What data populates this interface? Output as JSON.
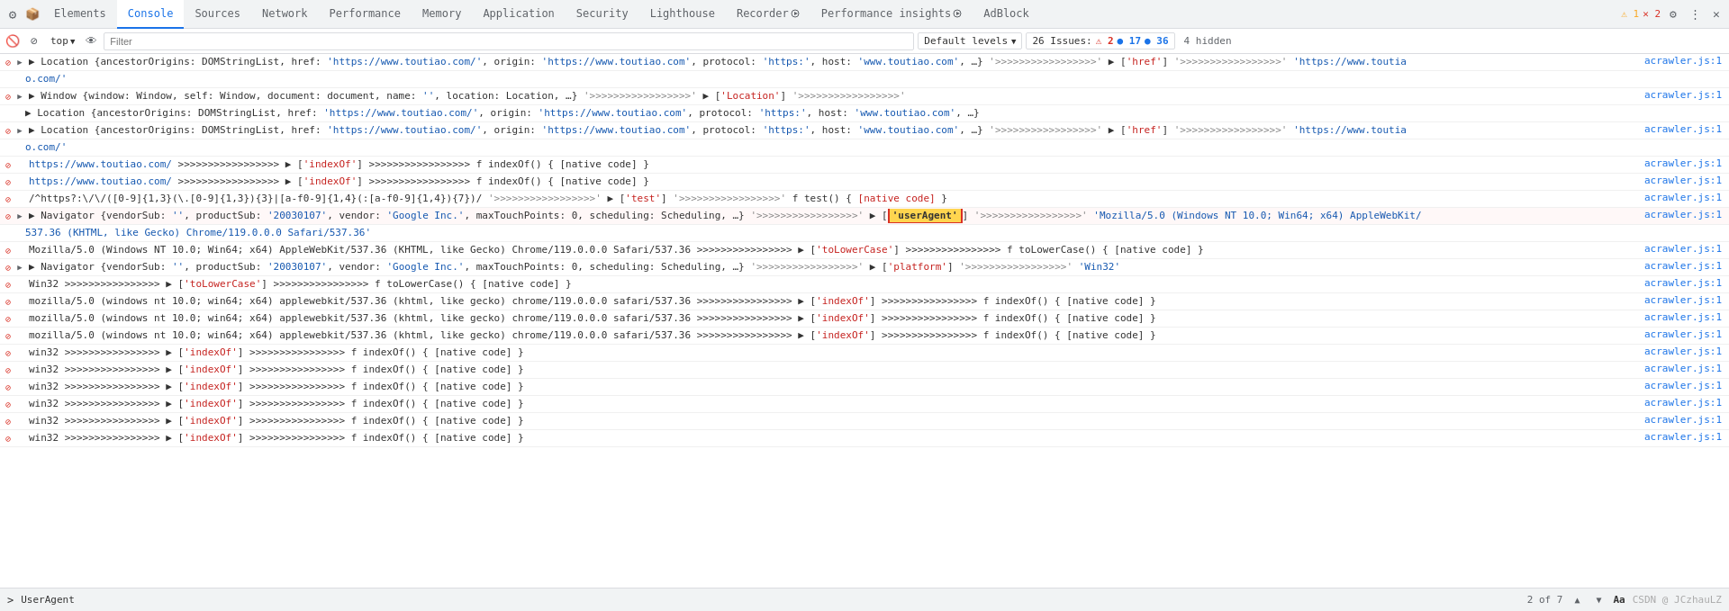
{
  "tabs": [
    {
      "label": "Elements",
      "active": false
    },
    {
      "label": "Console",
      "active": true
    },
    {
      "label": "Sources",
      "active": false
    },
    {
      "label": "Network",
      "active": false
    },
    {
      "label": "Performance",
      "active": false
    },
    {
      "label": "Memory",
      "active": false
    },
    {
      "label": "Application",
      "active": false
    },
    {
      "label": "Security",
      "active": false
    },
    {
      "label": "Lighthouse",
      "active": false
    },
    {
      "label": "Recorder",
      "active": false
    },
    {
      "label": "Performance insights",
      "active": false
    },
    {
      "label": "AdBlock",
      "active": false
    }
  ],
  "console_toolbar": {
    "filter_placeholder": "Filter",
    "default_levels": "Default levels",
    "issues_label": "26 Issues:",
    "issues_red": "2",
    "issues_blue1": "17",
    "issues_blue2": "36",
    "hidden": "4 hidden"
  },
  "console_rows": [
    {
      "icon": "error",
      "expandable": true,
      "content": "▶ Location {ancestorOrigins: DOMStringList, href: 'https://www.toutiao.com/', origin: 'https://www.toutiao.com', protocol: 'https:', host: 'www.toutiao.com', …} '>>>>>>>>>>>>>>>>>' ▶ ['href'] '>>>>>>>>>>>>>>>>>' 'https://www.toutia",
      "source": "acrawler.js:1",
      "indent": false
    },
    {
      "icon": "none",
      "expandable": false,
      "content": "o.com/'",
      "source": "",
      "indent": true
    },
    {
      "icon": "error",
      "expandable": true,
      "content": "▶ Window {window: Window, self: Window, document: document, name: '', location: Location, …} '>>>>>>>>>>>>>>>>>' ▶ ['Location'] '>>>>>>>>>>>>>>>>>'",
      "source": "acrawler.js:1",
      "indent": false
    },
    {
      "icon": "none",
      "expandable": false,
      "content": "▶ Location {ancestorOrigins: DOMStringList, href: 'https://www.toutiao.com/', origin: 'https://www.toutiao.com', protocol: 'https:', host: 'www.toutiao.com', …}",
      "source": "",
      "indent": true
    },
    {
      "icon": "error",
      "expandable": true,
      "content": "▶ Location {ancestorOrigins: DOMStringList, href: 'https://www.toutiao.com/', origin: 'https://www.toutiao.com', protocol: 'https:', host: 'www.toutiao.com', …} '>>>>>>>>>>>>>>>>>' ▶ ['href'] '>>>>>>>>>>>>>>>>>' 'https://www.toutia",
      "source": "acrawler.js:1",
      "indent": false
    },
    {
      "icon": "none",
      "expandable": false,
      "content": "o.com/'",
      "source": "",
      "indent": true
    },
    {
      "icon": "error",
      "expandable": false,
      "content": "https://www.toutiao.com/ >>>>>>>>>>>>>>>>>  ▶ ['indexOf'] >>>>>>>>>>>>>>>>>  f indexOf() { [native code] }",
      "source": "acrawler.js:1",
      "indent": false
    },
    {
      "icon": "error",
      "expandable": false,
      "content": "https://www.toutiao.com/ >>>>>>>>>>>>>>>>>  ▶ ['indexOf'] >>>>>>>>>>>>>>>>>  f indexOf() { [native code] }",
      "source": "acrawler.js:1",
      "indent": false
    },
    {
      "icon": "error",
      "expandable": false,
      "content": "/^https?:\\/\\/([0-9]{1,3}(\\.[0-9]{1,3}){3}|[a-f0-9]{1,4}(:[a-f0-9]{1,4}){7})/ '>>>>>>>>>>>>>>>>>' ▶ ['test'] '>>>>>>>>>>>>>>>>>' f test() { [native code] }",
      "source": "acrawler.js:1",
      "indent": false
    },
    {
      "icon": "error",
      "expandable": true,
      "content": "▶ Navigator {vendorSub: '', productSub: '20030107', vendor: 'Google Inc.', maxTouchPoints: 0, scheduling: Scheduling, …} '>>>>>>>>>>>>>>>>>' ▶ ['userAgent'] '>>>>>>>>>>>>>>>>>' 'Mozilla/5.0 (Windows NT 10.0; Win64; x64) AppleWebKit/",
      "source": "acrawler.js:1",
      "indent": false,
      "has_red_box": true,
      "red_box_text": "userAgent"
    },
    {
      "icon": "none",
      "expandable": false,
      "content": "537.36 (KHTML, like Gecko) Chrome/119.0.0.0 Safari/537.36'",
      "source": "",
      "indent": true
    },
    {
      "icon": "error",
      "expandable": false,
      "content": "Mozilla/5.0 (Windows NT 10.0; Win64; x64) AppleWebKit/537.36 (KHTML, like Gecko) Chrome/119.0.0.0 Safari/537.36 >>>>>>>>>>>>>>>>>> ▶ ['toLowerCase'] >>>>>>>>>>>>>>>>>> f toLowerCase() { [native code] }",
      "source": "acrawler.js:1",
      "indent": false
    },
    {
      "icon": "error",
      "expandable": true,
      "content": "▶ Navigator {vendorSub: '', productSub: '20030107', vendor: 'Google Inc.', maxTouchPoints: 0, scheduling: Scheduling, …} '>>>>>>>>>>>>>>>>>' ▶ ['platform'] '>>>>>>>>>>>>>>>>>' 'Win32'",
      "source": "acrawler.js:1",
      "indent": false
    },
    {
      "icon": "error",
      "expandable": false,
      "content": "Win32 >>>>>>>>>>>>>>>>>> ▶ ['toLowerCase'] >>>>>>>>>>>>>>>>>> f toLowerCase() { [native code] }",
      "source": "acrawler.js:1",
      "indent": false
    },
    {
      "icon": "error",
      "expandable": false,
      "content": "mozilla/5.0 (windows nt 10.0; win64; x64) applewebkit/537.36 (khtml, like gecko) chrome/119.0.0.0 safari/537.36 >>>>>>>>>>>>>>>>>> ▶ ['indexOf'] >>>>>>>>>>>>>>>>>> f indexOf() { [native code] }",
      "source": "acrawler.js:1",
      "indent": false
    },
    {
      "icon": "error",
      "expandable": false,
      "content": "mozilla/5.0 (windows nt 10.0; win64; x64) applewebkit/537.36 (khtml, like gecko) chrome/119.0.0.0 safari/537.36 >>>>>>>>>>>>>>>>>> ▶ ['indexOf'] >>>>>>>>>>>>>>>>>> f indexOf() { [native code] }",
      "source": "acrawler.js:1",
      "indent": false
    },
    {
      "icon": "error",
      "expandable": false,
      "content": "mozilla/5.0 (windows nt 10.0; win64; x64) applewebkit/537.36 (khtml, like gecko) chrome/119.0.0.0 safari/537.36 >>>>>>>>>>>>>>>>>> ▶ ['indexOf'] >>>>>>>>>>>>>>>>>> f indexOf() { [native code] }",
      "source": "acrawler.js:1",
      "indent": false
    },
    {
      "icon": "error",
      "expandable": false,
      "content": "win32 >>>>>>>>>>>>>>>>>> ▶ ['indexOf'] >>>>>>>>>>>>>>>>>> f indexOf() { [native code] }",
      "source": "acrawler.js:1",
      "indent": false
    },
    {
      "icon": "error",
      "expandable": false,
      "content": "win32 >>>>>>>>>>>>>>>>>> ▶ ['indexOf'] >>>>>>>>>>>>>>>>>> f indexOf() { [native code] }",
      "source": "acrawler.js:1",
      "indent": false
    },
    {
      "icon": "error",
      "expandable": false,
      "content": "win32 >>>>>>>>>>>>>>>>>> ▶ ['indexOf'] >>>>>>>>>>>>>>>>>> f indexOf() { [native code] }",
      "source": "acrawler.js:1",
      "indent": false
    },
    {
      "icon": "error",
      "expandable": false,
      "content": "win32 >>>>>>>>>>>>>>>>>> ▶ ['indexOf'] >>>>>>>>>>>>>>>>>> f indexOf() { [native code] }",
      "source": "acrawler.js:1",
      "indent": false
    },
    {
      "icon": "error",
      "expandable": false,
      "content": "win32 >>>>>>>>>>>>>>>>>> ▶ ['indexOf'] >>>>>>>>>>>>>>>>>> f indexOf() { [native code] }",
      "source": "acrawler.js:1",
      "indent": false
    },
    {
      "icon": "error",
      "expandable": false,
      "content": "win32 >>>>>>>>>>>>>>>>>> ▶ ['indexOf'] >>>>>>>>>>>>>>>>>> f indexOf() { [native code] }",
      "source": "acrawler.js:1",
      "indent": false
    }
  ],
  "bottom_bar": {
    "input_value": "UserAgent",
    "nav_count": "2 of 7",
    "aa_label": "Aa",
    "right_text": "CSDN @ JCzhauLZ"
  },
  "top_right": {
    "warning_count": "1",
    "error_count": "2"
  }
}
